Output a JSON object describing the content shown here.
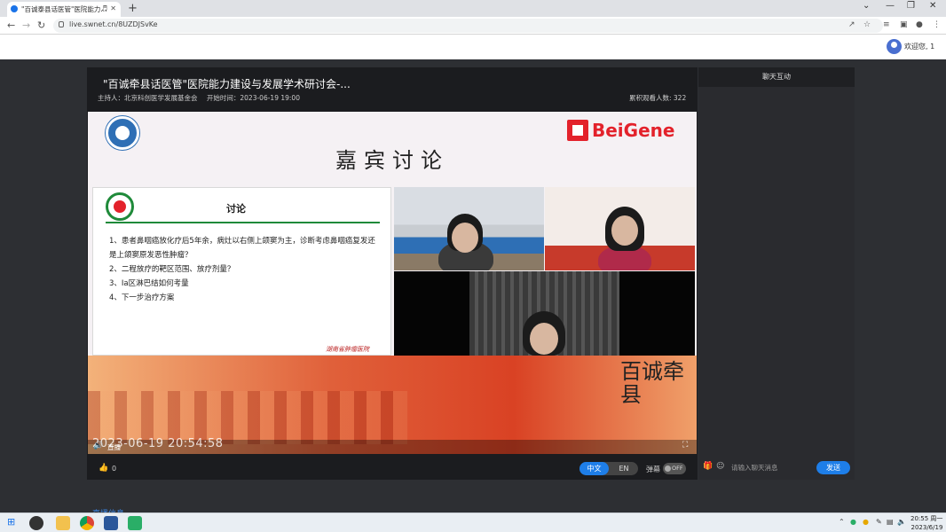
{
  "browser": {
    "tab_title": "\"百诚泰县话医管\"医院能力...",
    "new_tab": "+",
    "url": "live.swnet.cn/8UZDJSvKe",
    "window_controls": [
      "minimize-icon",
      "restore-icon",
      "close-icon"
    ]
  },
  "site": {
    "welcome": "欢迎您, 1"
  },
  "live": {
    "title": "\"百诚牵县话医管\"医院能力建设与发展学术研讨会-...",
    "host": "主持人：北京科创医学发展基金会",
    "start_time": "开始时间：2023-06-19 19:00",
    "viewers": "累积观看人数: 322"
  },
  "stage": {
    "heading": "嘉宾讨论",
    "sponsor": "BeiGene",
    "slide": {
      "title": "讨论",
      "items": [
        "1、患者鼻咽癌放化疗后5年余，病灶以右侧上颌窦为主，诊断考虑鼻咽癌复发还是上颌窦原发恶性肿瘤？",
        "2、二程放疗的靶区范围、放疗剂量？",
        "3、Ia区淋巴结如何考量",
        "4、下一步治疗方案"
      ],
      "signature": "湖南省肿瘤医院"
    },
    "banner_logo": "百诚牵县"
  },
  "player": {
    "timestamp": "2023-06-19 20:54:58",
    "live_label": "直播",
    "likes": "0",
    "lang_zh": "中文",
    "lang_en": "EN",
    "danmu_label": "弹幕",
    "danmu_state": "OFF"
  },
  "chat": {
    "header": "聊天互动",
    "input_placeholder": "请输入聊天消息",
    "send": "发送"
  },
  "page_below": {
    "tab": "直播信息"
  },
  "taskbar": {
    "time": "20:55 周一",
    "date": "2023/6/19"
  },
  "colors": {
    "accent": "#1e7ee8",
    "brand_red": "#e3222b",
    "slide_green": "#1f8a3a"
  }
}
